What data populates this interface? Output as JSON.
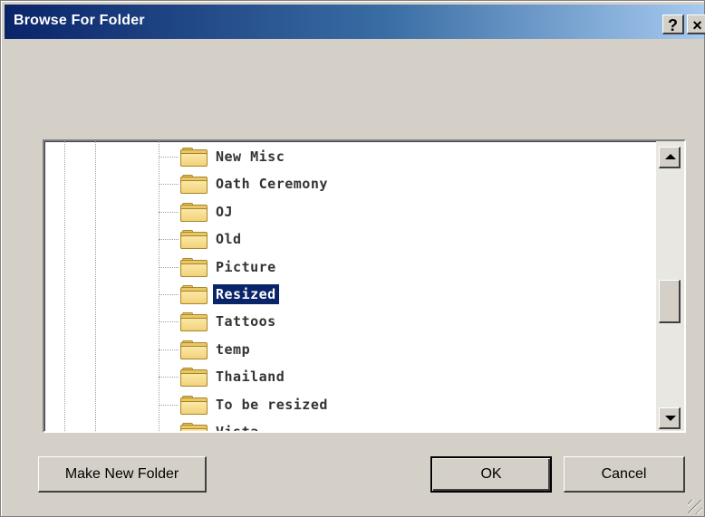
{
  "window": {
    "title": "Browse For Folder",
    "help_label": "?",
    "close_label": "×"
  },
  "tree": {
    "items": [
      {
        "label": "New Misc",
        "selected": false
      },
      {
        "label": "Oath Ceremony",
        "selected": false
      },
      {
        "label": "OJ",
        "selected": false
      },
      {
        "label": "Old",
        "selected": false
      },
      {
        "label": "Picture",
        "selected": false
      },
      {
        "label": "Resized",
        "selected": true
      },
      {
        "label": "Tattoos",
        "selected": false
      },
      {
        "label": "temp",
        "selected": false
      },
      {
        "label": "Thailand",
        "selected": false
      },
      {
        "label": "To be resized",
        "selected": false
      },
      {
        "label": "Vista",
        "selected": false
      }
    ],
    "scroll_position": 0.58
  },
  "buttons": {
    "make_new_folder": "Make New Folder",
    "ok": "OK",
    "cancel": "Cancel"
  },
  "colors": {
    "selection": "#0a246a",
    "title_start": "#0a246a",
    "title_end": "#a6caf0",
    "folder": "#e9c765"
  }
}
